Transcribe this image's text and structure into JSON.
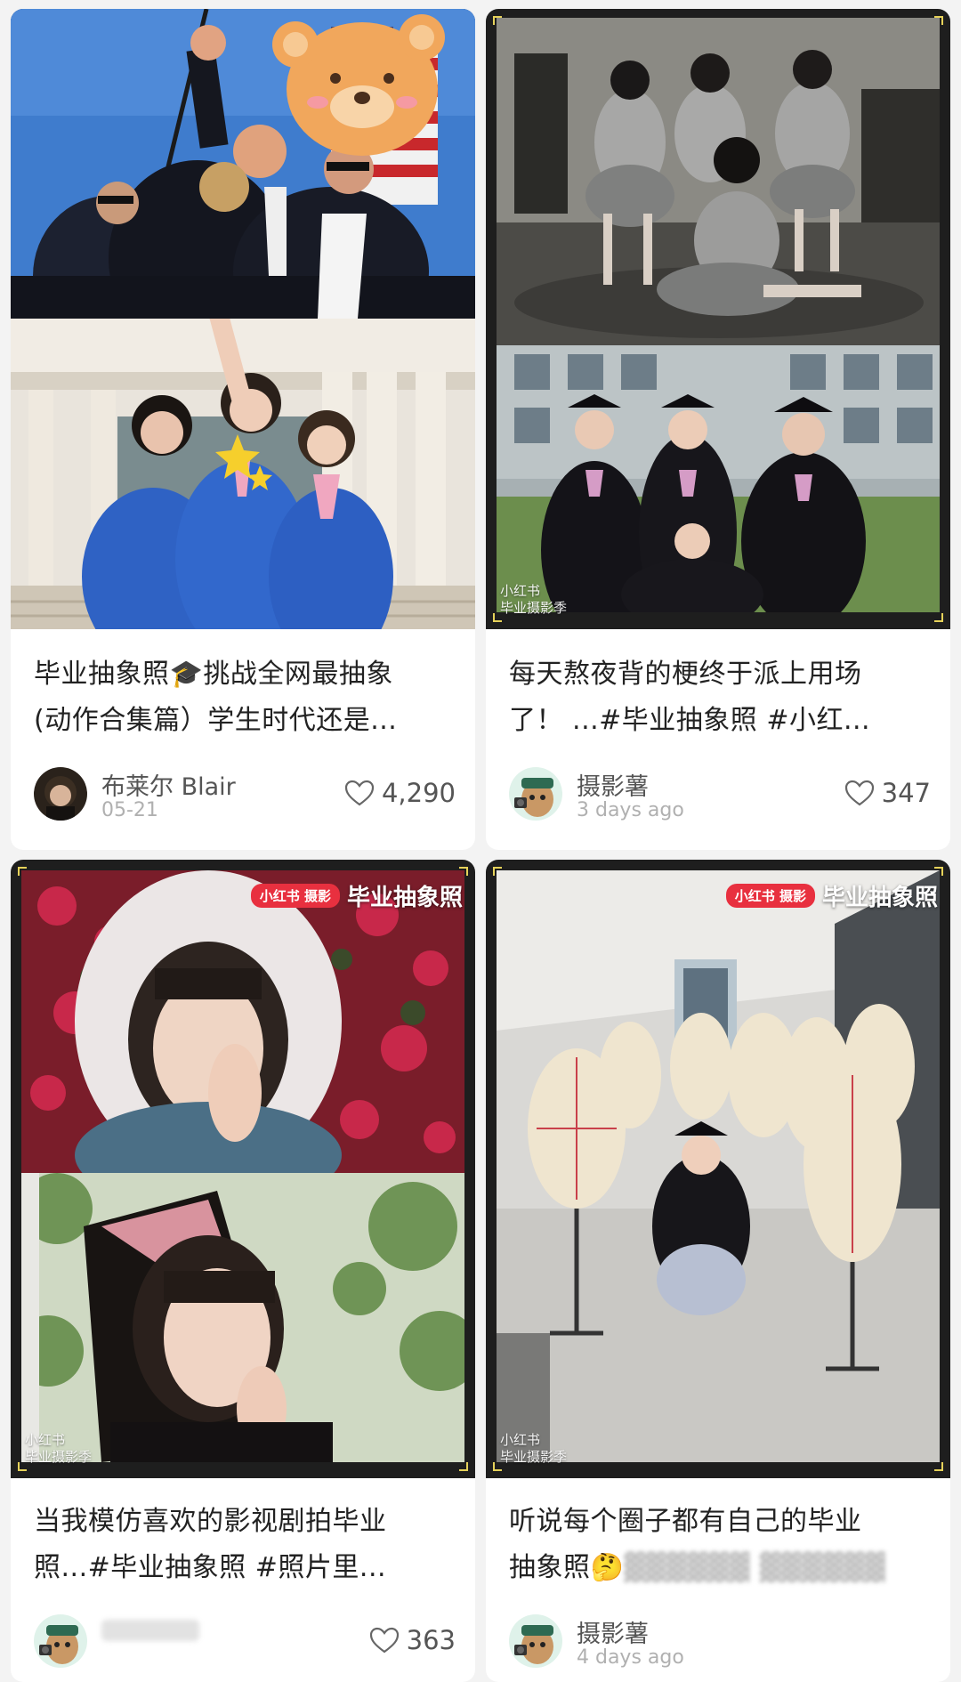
{
  "feed": {
    "cards": [
      {
        "title_line1": "毕业抽象照🎓挑战全网最抽象",
        "title_line2": "(动作合集篇）学生时代还是...",
        "author": "布莱尔 Blair",
        "date": "05-21",
        "likes": "4,290",
        "avatar_icon": "user-avatar-photo",
        "cover_watermark": ""
      },
      {
        "title_line1": "每天熬夜背的梗终于派上用场",
        "title_line2": "了！ ...#毕业抽象照   #小红...",
        "author": "摄影薯",
        "date": "3 days ago",
        "likes": "347",
        "avatar_icon": "potato-photographer-avatar",
        "cover_watermark_line1": "小红书",
        "cover_watermark_line2": "毕业摄影季"
      },
      {
        "title_line1": "当我模仿喜欢的影视剧拍毕业",
        "title_line2": "照...#毕业抽象照   #照片里...",
        "author": "",
        "date": "",
        "likes": "363",
        "avatar_icon": "potato-photographer-avatar",
        "cover_badge": "小红书 摄影",
        "cover_heading": "毕业抽象照",
        "cover_watermark_line1": "小红书",
        "cover_watermark_line2": "毕业摄影季"
      },
      {
        "title_line1": "听说每个圈子都有自己的毕业",
        "title_line2_prefix": "抽象照🤔",
        "author": "摄影薯",
        "date": "4 days ago",
        "likes": "",
        "avatar_icon": "potato-photographer-avatar",
        "cover_badge": "小红书 摄影",
        "cover_heading": "毕业抽象照",
        "cover_watermark_line1": "小红书",
        "cover_watermark_line2": "毕业摄影季"
      }
    ]
  },
  "colors": {
    "background": "#f3f3f3",
    "card": "#ffffff",
    "title_text": "#222222",
    "meta_text": "#555555",
    "date_text": "#b0b0b0",
    "badge_red": "#e8303f",
    "corner_yellow": "#e6d25a"
  }
}
